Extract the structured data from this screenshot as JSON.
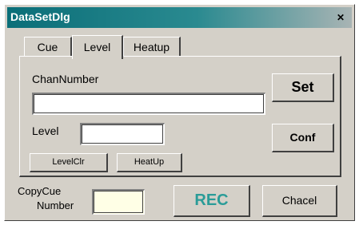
{
  "window": {
    "title": "DataSetDlg",
    "close_label": "✕"
  },
  "tabs": [
    {
      "label": "Cue"
    },
    {
      "label": "Level"
    },
    {
      "label": "Heatup"
    }
  ],
  "panel": {
    "chan_number_label": "ChanNumber",
    "chan_number_value": "",
    "level_label": "Level",
    "level_value": "",
    "set_label": "Set",
    "conf_label": "Conf",
    "level_clear_label": "LevelClr",
    "heatup_label": "HeatUp"
  },
  "footer": {
    "copy_cue_label_line1": "CopyCue",
    "copy_cue_label_line2": "Number",
    "copy_cue_value": "",
    "rec_label": "REC",
    "cancel_label": "Chacel"
  },
  "colors": {
    "title_bar": "#0a6e78",
    "rec_text": "#2a9c98",
    "face": "#d4d0c8",
    "copy_field": "#ffffe6"
  }
}
